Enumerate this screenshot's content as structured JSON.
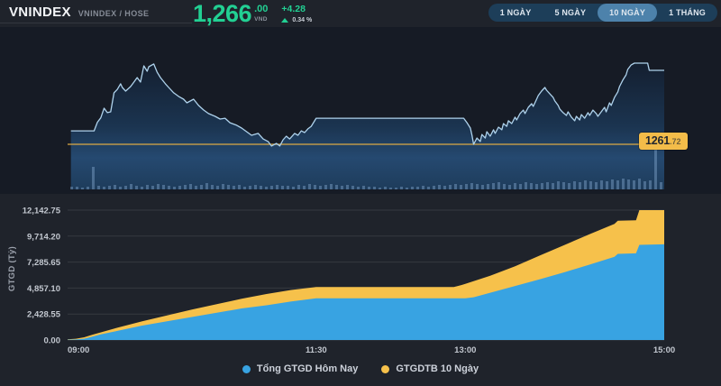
{
  "header": {
    "title": "VNINDEX",
    "subtitle": "VNINDEX / HOSE",
    "price": {
      "integer": "1,266",
      "decimals": ".00",
      "currency": "VND",
      "change": "+4.28",
      "change_pct": "0.34 %"
    },
    "range_buttons": [
      {
        "label": "1 NGÀY",
        "active": false
      },
      {
        "label": "5 NGÀY",
        "active": false
      },
      {
        "label": "10 NGÀY",
        "active": true
      },
      {
        "label": "1 THÁNG",
        "active": false
      }
    ]
  },
  "colors": {
    "accent_green": "#22d093",
    "price_line": "#aed2ec",
    "reference_yellow": "#dcaa45",
    "label_bg": "#f3bc49",
    "volume_blue": "#38a3e2",
    "average_yellow": "#f6c14b",
    "button_group_bg": "#1d3e59",
    "button_active_bg": "#4d82ab"
  },
  "chart_data": [
    {
      "type": "line",
      "title": "VNINDEX intraday price",
      "x_unit": "minutes from 09:00",
      "x_range": [
        0,
        360
      ],
      "line_color": "#aed2ec",
      "reference_line": {
        "value": 1261.72,
        "label_main": "1261",
        "label_decimals": ".72",
        "color": "#dcaa45"
      },
      "points": [
        [
          2,
          1262.5
        ],
        [
          16,
          1262.5
        ],
        [
          18,
          1263.0
        ],
        [
          20,
          1263.25
        ],
        [
          22,
          1263.81
        ],
        [
          24,
          1263.55
        ],
        [
          26,
          1263.6
        ],
        [
          28,
          1264.7
        ],
        [
          30,
          1264.9
        ],
        [
          32,
          1265.22
        ],
        [
          33,
          1265.01
        ],
        [
          35,
          1264.8
        ],
        [
          38,
          1265.06
        ],
        [
          40,
          1265.32
        ],
        [
          42,
          1265.58
        ],
        [
          44,
          1265.32
        ],
        [
          46,
          1266.26
        ],
        [
          48,
          1265.95
        ],
        [
          49,
          1266.21
        ],
        [
          52,
          1266.37
        ],
        [
          54,
          1265.9
        ],
        [
          56,
          1265.58
        ],
        [
          59,
          1265.22
        ],
        [
          61,
          1265.01
        ],
        [
          64,
          1264.7
        ],
        [
          67,
          1264.49
        ],
        [
          70,
          1264.33
        ],
        [
          72,
          1264.12
        ],
        [
          76,
          1264.33
        ],
        [
          79,
          1263.97
        ],
        [
          82,
          1263.71
        ],
        [
          85,
          1263.5
        ],
        [
          89,
          1263.34
        ],
        [
          92,
          1263.18
        ],
        [
          95,
          1263.23
        ],
        [
          98,
          1262.97
        ],
        [
          102,
          1262.82
        ],
        [
          105,
          1262.66
        ],
        [
          108,
          1262.45
        ],
        [
          111,
          1262.24
        ],
        [
          115,
          1262.35
        ],
        [
          118,
          1262.03
        ],
        [
          121,
          1261.88
        ],
        [
          123,
          1261.62
        ],
        [
          126,
          1261.77
        ],
        [
          128,
          1261.62
        ],
        [
          130,
          1261.98
        ],
        [
          132,
          1262.19
        ],
        [
          134,
          1262.03
        ],
        [
          137,
          1262.35
        ],
        [
          139,
          1262.24
        ],
        [
          141,
          1262.5
        ],
        [
          143,
          1262.4
        ],
        [
          145,
          1262.61
        ],
        [
          147,
          1262.76
        ],
        [
          150,
          1263.23
        ],
        [
          239,
          1263.23
        ],
        [
          241,
          1262.97
        ],
        [
          243,
          1262.66
        ],
        [
          244,
          1262.24
        ],
        [
          245,
          1261.72
        ],
        [
          247,
          1262.08
        ],
        [
          249,
          1261.88
        ],
        [
          250,
          1262.29
        ],
        [
          252,
          1262.08
        ],
        [
          253,
          1262.45
        ],
        [
          255,
          1262.19
        ],
        [
          257,
          1262.56
        ],
        [
          258,
          1262.35
        ],
        [
          260,
          1262.71
        ],
        [
          262,
          1262.56
        ],
        [
          263,
          1262.92
        ],
        [
          265,
          1262.76
        ],
        [
          266,
          1263.08
        ],
        [
          268,
          1262.92
        ],
        [
          270,
          1263.29
        ],
        [
          271,
          1263.13
        ],
        [
          273,
          1263.5
        ],
        [
          275,
          1263.7
        ],
        [
          276,
          1263.5
        ],
        [
          278,
          1263.86
        ],
        [
          280,
          1264.07
        ],
        [
          281,
          1263.91
        ],
        [
          283,
          1264.33
        ],
        [
          284,
          1264.54
        ],
        [
          286,
          1264.8
        ],
        [
          288,
          1265.01
        ],
        [
          289,
          1264.85
        ],
        [
          291,
          1264.64
        ],
        [
          293,
          1264.43
        ],
        [
          294,
          1264.23
        ],
        [
          296,
          1263.97
        ],
        [
          297,
          1263.76
        ],
        [
          299,
          1263.55
        ],
        [
          301,
          1263.39
        ],
        [
          302,
          1263.6
        ],
        [
          304,
          1263.29
        ],
        [
          306,
          1263.08
        ],
        [
          307,
          1263.34
        ],
        [
          309,
          1263.13
        ],
        [
          310,
          1263.44
        ],
        [
          312,
          1263.23
        ],
        [
          314,
          1263.55
        ],
        [
          315,
          1263.39
        ],
        [
          317,
          1263.7
        ],
        [
          319,
          1263.5
        ],
        [
          320,
          1263.34
        ],
        [
          322,
          1263.6
        ],
        [
          324,
          1263.86
        ],
        [
          325,
          1263.6
        ],
        [
          327,
          1264.12
        ],
        [
          328,
          1263.97
        ],
        [
          330,
          1264.43
        ],
        [
          332,
          1264.75
        ],
        [
          333,
          1265.06
        ],
        [
          335,
          1265.43
        ],
        [
          337,
          1265.74
        ],
        [
          338,
          1266.05
        ],
        [
          340,
          1266.31
        ],
        [
          342,
          1266.42
        ],
        [
          350,
          1266.42
        ],
        [
          351,
          1266.0
        ],
        [
          360,
          1266.0
        ]
      ],
      "volume_bars": [
        3,
        3,
        2,
        3,
        25,
        4,
        3,
        4,
        5,
        3,
        4,
        6,
        4,
        3,
        5,
        4,
        6,
        5,
        4,
        3,
        4,
        5,
        6,
        4,
        5,
        7,
        5,
        4,
        6,
        5,
        4,
        5,
        3,
        4,
        5,
        4,
        3,
        4,
        5,
        4,
        4,
        3,
        5,
        4,
        6,
        5,
        4,
        5,
        6,
        5,
        4,
        5,
        4,
        3,
        4,
        3,
        3,
        2,
        3,
        2,
        2,
        3,
        2,
        3,
        3,
        4,
        3,
        4,
        5,
        4,
        5,
        6,
        5,
        6,
        7,
        6,
        5,
        6,
        7,
        8,
        6,
        5,
        7,
        6,
        8,
        7,
        6,
        7,
        8,
        7,
        9,
        8,
        7,
        9,
        8,
        10,
        9,
        8,
        10,
        9,
        11,
        10,
        12,
        11,
        10,
        12,
        9,
        10,
        45,
        8
      ]
    },
    {
      "type": "area",
      "ylabel": "GTGD (Tỷ)",
      "ylim": [
        0,
        12142.75
      ],
      "x_range": [
        0,
        360
      ],
      "yticks": [
        {
          "value": 0,
          "label": "0.00"
        },
        {
          "value": 2428.55,
          "label": "2,428.55"
        },
        {
          "value": 4857.1,
          "label": "4,857.10"
        },
        {
          "value": 7285.65,
          "label": "7,285.65"
        },
        {
          "value": 9714.2,
          "label": "9,714.20"
        },
        {
          "value": 12142.75,
          "label": "12,142.75"
        }
      ],
      "xticks": [
        {
          "t": 0,
          "label": "09:00"
        },
        {
          "t": 150,
          "label": "11:30"
        },
        {
          "t": 240,
          "label": "13:00"
        },
        {
          "t": 360,
          "label": "15:00"
        }
      ],
      "series": [
        {
          "name": "GTGDTB 10 Ngày",
          "color": "#f6c14b",
          "points": [
            [
              0,
              60
            ],
            [
              5,
              120
            ],
            [
              10,
              250
            ],
            [
              15,
              500
            ],
            [
              30,
              1150
            ],
            [
              45,
              1750
            ],
            [
              60,
              2300
            ],
            [
              75,
              2850
            ],
            [
              90,
              3350
            ],
            [
              105,
              3850
            ],
            [
              120,
              4300
            ],
            [
              135,
              4680
            ],
            [
              150,
              4950
            ],
            [
              233,
              4950
            ],
            [
              238,
              5150
            ],
            [
              240,
              5250
            ],
            [
              255,
              6000
            ],
            [
              270,
              6900
            ],
            [
              285,
              7900
            ],
            [
              300,
              8900
            ],
            [
              315,
              9900
            ],
            [
              330,
              10850
            ],
            [
              332,
              11150
            ],
            [
              343,
              11200
            ],
            [
              345,
              12142.75
            ],
            [
              360,
              12142.75
            ]
          ]
        },
        {
          "name": "Tổng GTGD Hôm Nay",
          "color": "#38a3e2",
          "points": [
            [
              0,
              30
            ],
            [
              5,
              50
            ],
            [
              10,
              120
            ],
            [
              15,
              320
            ],
            [
              20,
              520
            ],
            [
              30,
              850
            ],
            [
              45,
              1350
            ],
            [
              60,
              1750
            ],
            [
              75,
              2150
            ],
            [
              90,
              2550
            ],
            [
              105,
              2950
            ],
            [
              120,
              3250
            ],
            [
              135,
              3600
            ],
            [
              150,
              3900
            ],
            [
              240,
              3900
            ],
            [
              245,
              4000
            ],
            [
              255,
              4420
            ],
            [
              270,
              5050
            ],
            [
              285,
              5680
            ],
            [
              300,
              6350
            ],
            [
              315,
              7050
            ],
            [
              330,
              7780
            ],
            [
              332,
              8050
            ],
            [
              343,
              8100
            ],
            [
              345,
              8900
            ],
            [
              360,
              8950
            ]
          ]
        }
      ]
    }
  ],
  "legend": {
    "items": [
      {
        "label": "Tổng GTGD Hôm Nay",
        "color": "#38a3e2"
      },
      {
        "label": "GTGDTB 10 Ngày",
        "color": "#f6c14b"
      }
    ]
  }
}
